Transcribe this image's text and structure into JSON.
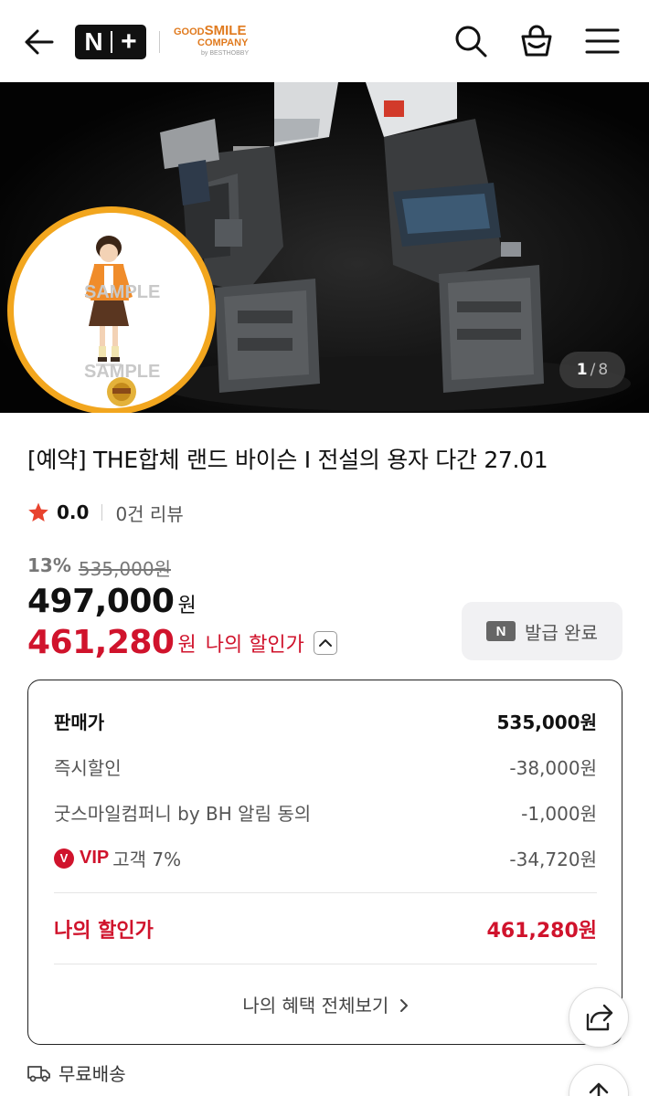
{
  "header": {
    "logo_n": "N",
    "logo_plus": "+",
    "brand_line1_a": "GOOD",
    "brand_line1_b": "SMILE",
    "brand_line2": "COMPANY",
    "brand_line3": "by BESTHOBBY"
  },
  "hero": {
    "counter_current": "1",
    "counter_slash": "/",
    "counter_total": "8",
    "sample_1": "SAMPLE",
    "sample_2": "SAMPLE"
  },
  "product": {
    "title": "[예약] THE합체 랜드 바이슨 I 전설의 용자 다간 27.01",
    "rating": "0.0",
    "reviews": "0건 리뷰",
    "discount_pct": "13%",
    "original_price": "535,000원",
    "price": "497,000",
    "won": "원",
    "my_price": "461,280",
    "my_price_label": "나의 할인가"
  },
  "coupon": {
    "badge": "N",
    "label": "발급 완료"
  },
  "breakdown": {
    "rows": [
      {
        "label": "판매가",
        "value": "535,000원"
      },
      {
        "label": "즉시할인",
        "value": "-38,000원"
      },
      {
        "label": "굿스마일컴퍼니 by BH 알림 동의",
        "value": "-1,000원"
      },
      {
        "label": "고객 7%",
        "value": "-34,720원",
        "badge": "V",
        "badge_word": "VIP"
      }
    ],
    "total_label": "나의 할인가",
    "total_value": "461,280원",
    "benefit_link": "나의 혜택 전체보기"
  },
  "shipping": {
    "label": "무료배송"
  },
  "colors": {
    "accent_red": "#d0132c",
    "badge_orange": "#f2a61e"
  },
  "icons": [
    "back-arrow-icon",
    "search-icon",
    "shopping-bag-icon",
    "menu-icon",
    "star-icon",
    "chevron-up-icon",
    "chevron-right-icon",
    "truck-icon",
    "share-icon",
    "arrow-up-icon"
  ]
}
